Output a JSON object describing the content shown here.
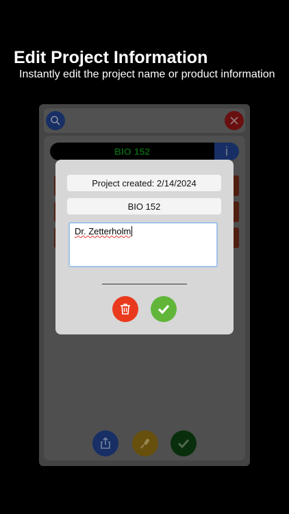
{
  "banner": {
    "title": "Edit Project Information",
    "subtitle": "Instantly edit the project name or product information"
  },
  "app": {
    "project_name": "BIO 152",
    "info_label": "i"
  },
  "dialog": {
    "created_text": "Project created: 2/14/2024",
    "name_value": "BIO 152",
    "notes_value": "Dr. Zetterholm"
  },
  "colors": {
    "accent_blue": "#1f3f86",
    "delete_red": "#ea3a1e",
    "confirm_green": "#61b63a",
    "project_green": "#0c7a17"
  }
}
